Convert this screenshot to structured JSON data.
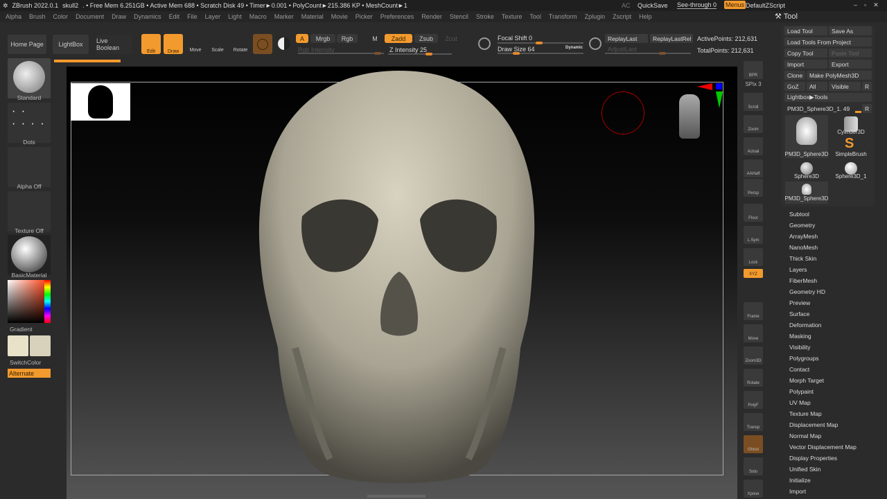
{
  "titlebar": {
    "app": "ZBrush 2022.0.1",
    "doc": "skull2",
    "stats": ". • Free Mem 6.251GB • Active Mem 688 • Scratch Disk 49 • Timer►0.001 • PolyCount►215.386 KP • MeshCount►1",
    "ac": "AC",
    "quicksave": "QuickSave",
    "seethrough": "See-through  0",
    "menus": "Menus",
    "script": "DefaultZScript"
  },
  "menu": [
    "Alpha",
    "Brush",
    "Color",
    "Document",
    "Draw",
    "Dynamics",
    "Edit",
    "File",
    "Layer",
    "Light",
    "Macro",
    "Marker",
    "Material",
    "Movie",
    "Picker",
    "Preferences",
    "Render",
    "Stencil",
    "Stroke",
    "Texture",
    "Tool",
    "Transform",
    "Zplugin",
    "Zscript",
    "Help"
  ],
  "toolbar": {
    "home": "Home Page",
    "lightbox": "LightBox",
    "liveboolean": "Live Boolean",
    "edit": "Edit",
    "draw": "Draw",
    "move": "Move",
    "scale": "Scale",
    "rotate": "Rotate",
    "a": "A",
    "mrgb": "Mrgb",
    "rgb": "Rgb",
    "m": "M",
    "zadd": "Zadd",
    "zsub": "Zsub",
    "zcut": "Zcut",
    "rgb_intensity": "Rgb Intensity",
    "z_intensity": "Z Intensity 25",
    "focal_shift": "Focal Shift 0",
    "draw_size": "Draw Size 64",
    "dynamic": "Dynamic",
    "replaylast": "ReplayLast",
    "replaylastrel": "ReplayLastRel",
    "adjustlast": "AdjustLast",
    "active_points": "ActivePoints: 212,631",
    "total_points": "TotalPoints: 212,631",
    "z_intensity_value": 25,
    "focal_shift_value": 0,
    "draw_size_value": 64
  },
  "left_shelf": {
    "brush": "Standard",
    "stroke": "Dots",
    "alpha": "Alpha Off",
    "texture": "Texture Off",
    "material": "BasicMaterial",
    "gradient": "Gradient",
    "switchcolor": "SwitchColor",
    "alternate": "Alternate"
  },
  "right_shelf": [
    "BPR",
    "SPix 3",
    "Scroll",
    "Zoom",
    "Actual",
    "AAHalf",
    "Persp",
    "Floor",
    "L.Sym",
    "Lock",
    "XYZ",
    "Frame",
    "Move",
    "Zoom3D",
    "Rotate",
    "PolyF",
    "Transp",
    "Ghost",
    "Solo",
    "Xpose"
  ],
  "tool_panel": {
    "title": "Tool",
    "load_tool": "Load Tool",
    "save_as": "Save As",
    "load_from_project": "Load Tools From Project",
    "copy_tool": "Copy Tool",
    "paste_tool": "Paste Tool",
    "import": "Import",
    "export": "Export",
    "clone": "Clone",
    "make_polymesh": "Make PolyMesh3D",
    "goz": "GoZ",
    "all": "All",
    "visible": "Visible",
    "r": "R",
    "lightbox_tools": "Lightbox▶Tools",
    "current_tool": "PM3D_Sphere3D_1. 49",
    "thumbs": [
      "PM3D_Sphere3D",
      "Cylinder3D",
      "SimpleBrush",
      "Sphere3D",
      "Sphere3D_1",
      "PM3D_Sphere3D"
    ],
    "subpalettes": [
      "Subtool",
      "Geometry",
      "ArrayMesh",
      "NanoMesh",
      "Thick Skin",
      "Layers",
      "FiberMesh",
      "Geometry HD",
      "Preview",
      "Surface",
      "Deformation",
      "Masking",
      "Visibility",
      "Polygroups",
      "Contact",
      "Morph Target",
      "Polypaint",
      "UV Map",
      "Texture Map",
      "Displacement Map",
      "Normal Map",
      "Vector Displacement Map",
      "Display Properties",
      "Unified Skin",
      "Initialize",
      "Import"
    ]
  },
  "colors": {
    "accent": "#f29a2e",
    "bg": "#2b2b2b"
  }
}
